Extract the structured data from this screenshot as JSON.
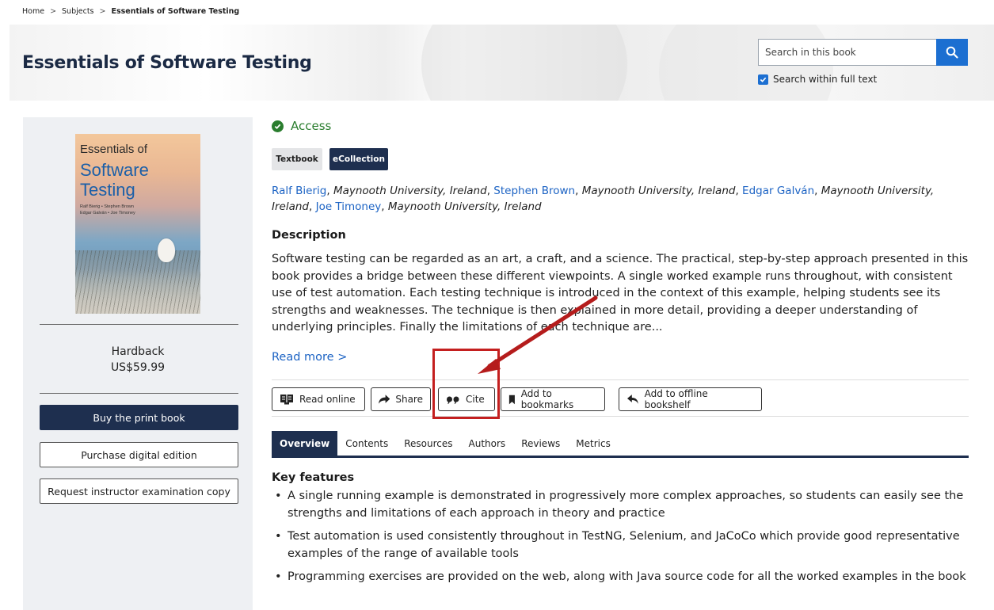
{
  "breadcrumb": {
    "home": "Home",
    "sep": ">",
    "subjects": "Subjects",
    "current": "Essentials of Software Testing"
  },
  "header": {
    "title": "Essentials of Software Testing",
    "search_placeholder": "Search in this book",
    "search_fulltext_label": "Search within full text",
    "search_fulltext_checked": true
  },
  "sidebar": {
    "cover": {
      "line1": "Essentials of",
      "line2": "Software",
      "line3": "Testing",
      "authors_line1": "Ralf Bierig • Stephen Brown",
      "authors_line2": "Edgar Galván • Joe Timoney"
    },
    "format": "Hardback",
    "price": "US$59.99",
    "buy_label": "Buy the print book",
    "digital_label": "Purchase digital edition",
    "exam_copy_label": "Request instructor examination copy"
  },
  "main": {
    "access": "Access",
    "tags": [
      "Textbook",
      "eCollection"
    ],
    "authors": [
      {
        "name": "Ralf Bierig",
        "affil": "Maynooth University, Ireland"
      },
      {
        "name": "Stephen Brown",
        "affil": "Maynooth University, Ireland"
      },
      {
        "name": "Edgar Galván",
        "affil": "Maynooth University, Ireland"
      },
      {
        "name": "Joe Timoney",
        "affil": "Maynooth University, Ireland"
      }
    ],
    "description_heading": "Description",
    "description": "Software testing can be regarded as an art, a craft, and a science. The practical, step-by-step approach presented in this book provides a bridge between these different viewpoints. A single worked example runs throughout, with consistent use of test automation. Each testing technique is introduced in the context of this example, helping students see its strengths and weaknesses. The technique is then explained in more detail, providing a deeper understanding of underlying principles. Finally the limitations of each technique are...",
    "read_more": "Read more >",
    "actions": {
      "read_online": "Read online",
      "share": "Share",
      "cite": "Cite",
      "bookmarks": "Add to bookmarks",
      "offline": "Add to offline bookshelf"
    },
    "tabs": [
      "Overview",
      "Contents",
      "Resources",
      "Authors",
      "Reviews",
      "Metrics"
    ],
    "key_features_heading": "Key features",
    "key_features": [
      "A single running example is demonstrated in progressively more complex approaches, so students can easily see the strengths and limitations of each approach in theory and practice",
      "Test automation is used consistently throughout in TestNG, Selenium, and JaCoCo which provide good representative examples of the range of available tools",
      "Programming exercises are provided on the web, along with Java source code for all the worked examples in the book"
    ]
  },
  "colors": {
    "navy": "#1e2f4f",
    "link": "#1c63c4",
    "access_green": "#2a7d2e",
    "highlight_red": "#c41f1f",
    "search_blue": "#1c6fd1"
  }
}
